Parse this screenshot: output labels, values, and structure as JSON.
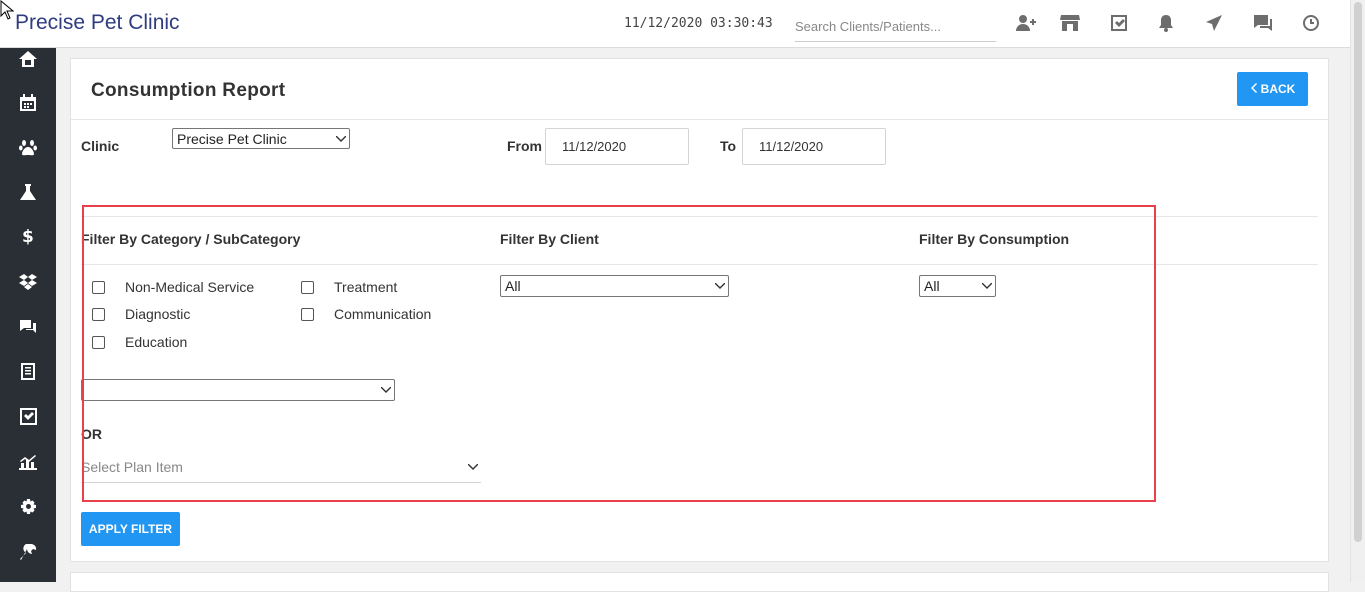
{
  "app": {
    "title": "Precise Pet Clinic",
    "datetime": "11/12/2020 03:30:43",
    "search_placeholder": "Search Clients/Patients..."
  },
  "top_icons": [
    "add-user-icon",
    "store-icon",
    "checkbox-icon",
    "bell-icon",
    "send-icon",
    "chat-icon",
    "clock-icon"
  ],
  "sidebar": {
    "items": [
      "home-icon",
      "calendar-icon",
      "paw-icon",
      "flask-icon",
      "dollar-icon",
      "dropbox-icon",
      "comments-icon",
      "report-icon",
      "checklist-icon",
      "analytics-icon",
      "gear-icon",
      "wrench-icon"
    ]
  },
  "report": {
    "title": "Consumption Report",
    "back_label": "BACK",
    "clinic_label": "Clinic",
    "clinic_value": "Precise Pet Clinic",
    "from_label": "From",
    "from_value": "11/12/2020",
    "to_label": "To",
    "to_value": "11/12/2020"
  },
  "filters": {
    "category_heading": "Filter By Category / SubCategory",
    "client_heading": "Filter By Client",
    "consumption_heading": "Filter By Consumption",
    "categories": {
      "non_medical": "Non-Medical Service",
      "treatment": "Treatment",
      "diagnostic": "Diagnostic",
      "communication": "Communication",
      "education": "Education"
    },
    "client_value": "All",
    "consumption_value": "All",
    "subcategory_value": "",
    "or_label": "OR",
    "plan_item_placeholder": "Select Plan Item",
    "apply_label": "APPLY FILTER"
  },
  "colors": {
    "brand": "#2f3c80",
    "accent": "#2196f3",
    "sidebar": "#2a2f35",
    "highlight": "#e8414a"
  }
}
